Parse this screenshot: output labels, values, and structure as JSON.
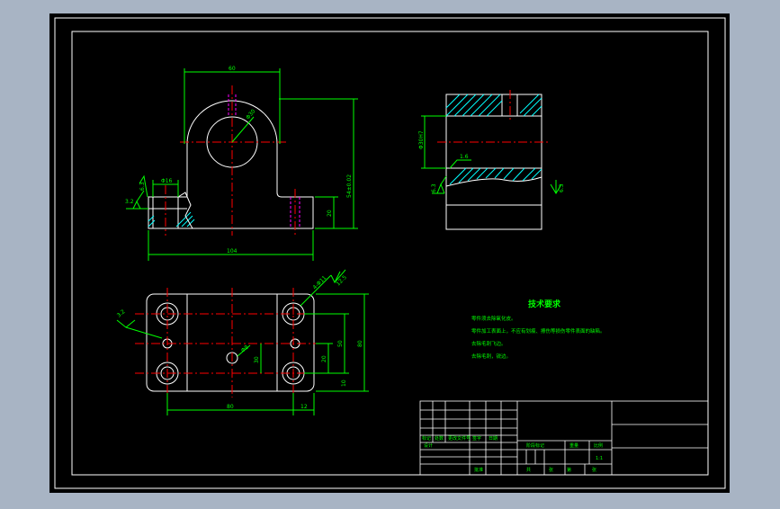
{
  "colors": {
    "background": "#a8b4c4",
    "sheet": "#000000",
    "outline": "#ffffff",
    "dimension": "#00ff00",
    "centerline": "#ff0000",
    "hidden": "#ff00ff",
    "hatch": "#00ffff",
    "note_text": "#ffff00"
  },
  "dims": {
    "top_width": "60",
    "bore": "Φ30",
    "height": "54±0.02",
    "base_h": "20",
    "total_len": "104",
    "cb_dia": "Φ16",
    "rough_left": "3.2",
    "rough_mid": "6.3",
    "side_dia": "Φ30H7",
    "side_rough": "1.6",
    "side_rough2": "6.3",
    "side_rough3": "6.3",
    "hole_rough": "3.2",
    "hole_count": "4-Φ11",
    "hole_rough2": "12.5",
    "pin": "Φ8",
    "h_20": "20",
    "h_30": "30",
    "h_50": "50",
    "h_80": "80",
    "h_10": "10",
    "w_80": "80",
    "w_12": "12"
  },
  "notes": {
    "title": "技术要求",
    "lines": [
      "零件须去除氧化皮。",
      "零件加工表面上，不应有划痕、擦伤等损伤零件表面的缺陷。",
      "去除毛刺飞边。",
      "去除毛刺，锐边。"
    ]
  },
  "title_block": {
    "r1": [
      "标记",
      "处数",
      "更改文件号",
      "签字",
      "日期"
    ],
    "design": "设计",
    "phase_labels": [
      "阶段标记",
      "重量",
      "比例"
    ],
    "scale": "1:1",
    "approve": "批准",
    "sheet_labels": [
      "共",
      "张",
      "第",
      "张"
    ]
  }
}
